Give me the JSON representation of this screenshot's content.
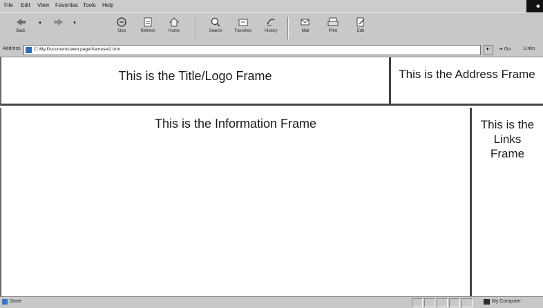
{
  "browser": {
    "menu": [
      "File",
      "Edit",
      "View",
      "Favorites",
      "Tools",
      "Help"
    ],
    "toolbar": {
      "back": "Back",
      "stop": "Stop",
      "refresh": "Refresh",
      "home": "Home",
      "search": "Search",
      "favorites": "Favorites",
      "history": "History",
      "mail": "Mail",
      "print": "Print",
      "edit": "Edit"
    },
    "address": {
      "label": "Address",
      "value": "C:\\My Documents\\web page\\frameset2.htm",
      "go_label": "Go",
      "links_label": "Links"
    },
    "status": {
      "text": "Done",
      "zone": "My Computer"
    }
  },
  "frames": {
    "title_frame": "This is the Title/Logo Frame",
    "address_frame": "This is the Address Frame",
    "info_frame": "This is the Information Frame",
    "links_frame": "This is the Links Frame"
  }
}
